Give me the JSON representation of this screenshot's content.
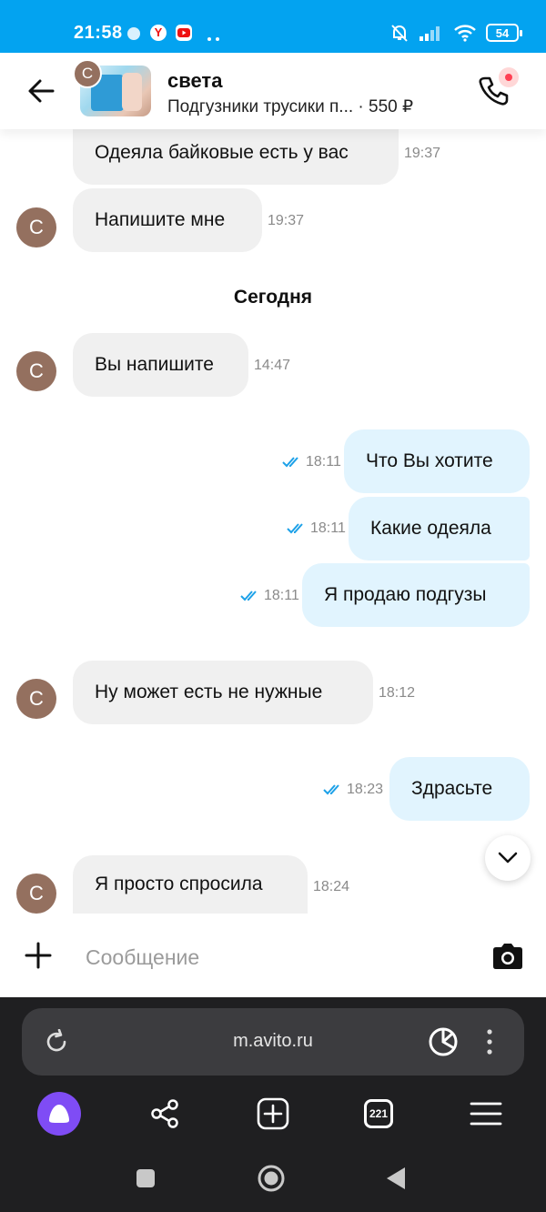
{
  "status_bar": {
    "time": "21:58",
    "battery": "54"
  },
  "header": {
    "contact_name": "света",
    "avatar_letter": "С",
    "listing_title": "Подгузники трусики п...",
    "price": "· 550 ₽"
  },
  "chat": {
    "day_separator": "Сегодня",
    "messages": [
      {
        "dir": "in",
        "text": "Одеяла байковые есть у вас",
        "time": "19:37"
      },
      {
        "dir": "in",
        "text": "Напишите мне",
        "time": "19:37"
      },
      {
        "dir": "in",
        "text": "Вы напишите",
        "time": "14:47"
      },
      {
        "dir": "out",
        "text": "Что Вы хотите",
        "time": "18:11"
      },
      {
        "dir": "out",
        "text": "Какие одеяла",
        "time": "18:11"
      },
      {
        "dir": "out",
        "text": "Я продаю подгузы",
        "time": "18:11"
      },
      {
        "dir": "in",
        "text": "Ну может есть не нужные",
        "time": "18:12"
      },
      {
        "dir": "out",
        "text": "Здрасьте",
        "time": "18:23"
      },
      {
        "dir": "in",
        "text": "Я просто спросила",
        "time": "18:24"
      }
    ]
  },
  "composer": {
    "placeholder": "Сообщение"
  },
  "browser": {
    "url": "m.avito.ru",
    "tabs_count": "221"
  },
  "colors": {
    "status_bar": "#03a3f0",
    "incoming_bubble": "#f0f0f0",
    "outgoing_bubble": "#e1f4fe",
    "avatar": "#94705f",
    "read_check": "#1da1e8",
    "alice": "#7f4cf5"
  },
  "icons": [
    "back-arrow-icon",
    "phone-icon",
    "plus-icon",
    "camera-icon",
    "reload-icon",
    "share-icon",
    "new-tab-icon",
    "menu-icon",
    "chevron-down-icon",
    "double-check-icon"
  ]
}
